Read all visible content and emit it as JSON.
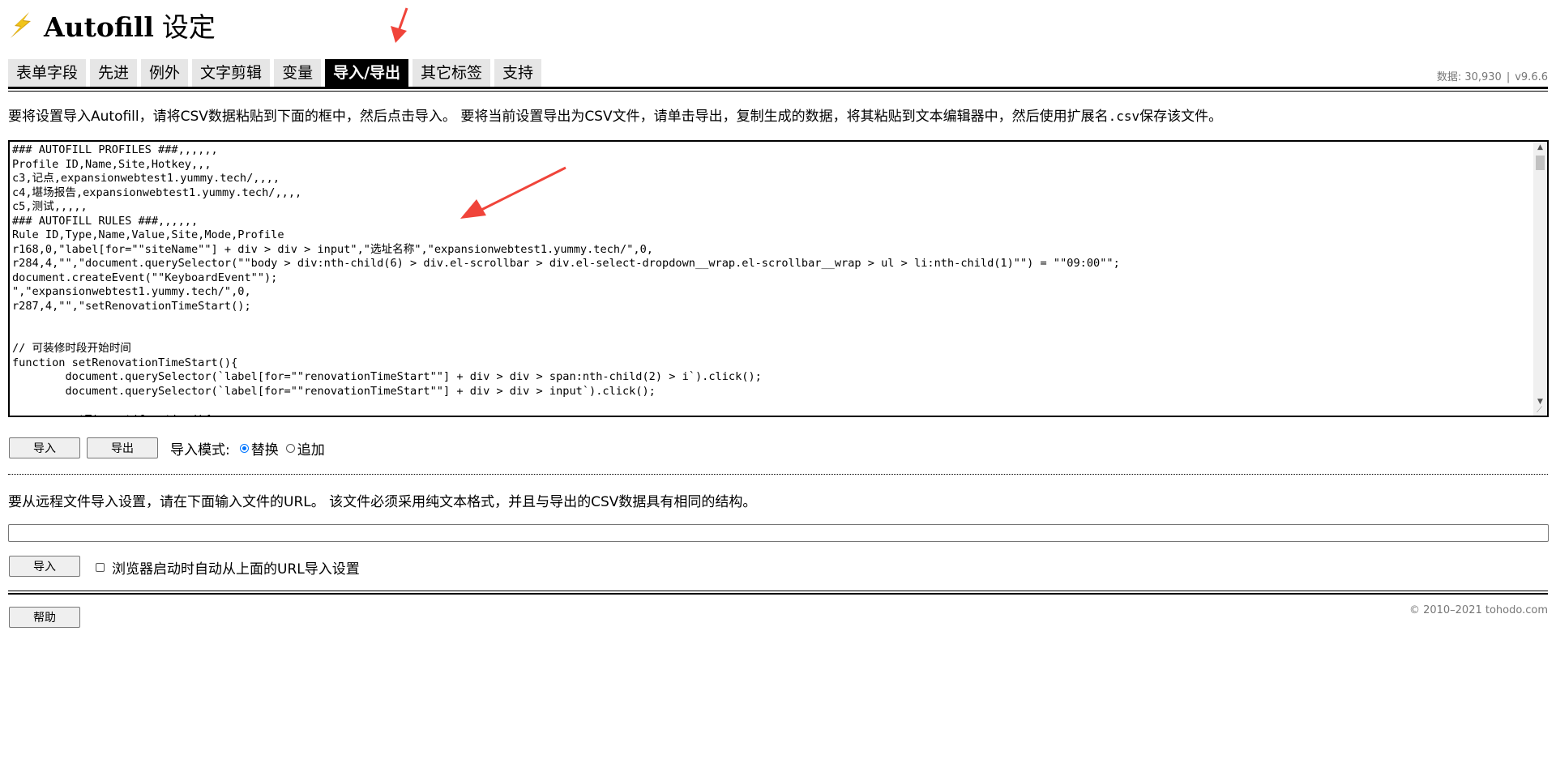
{
  "header": {
    "title": "Autofill",
    "title_suffix": "设定"
  },
  "tabs": [
    {
      "label": "表单字段",
      "active": false
    },
    {
      "label": "先进",
      "active": false
    },
    {
      "label": "例外",
      "active": false
    },
    {
      "label": "文字剪辑",
      "active": false
    },
    {
      "label": "变量",
      "active": false
    },
    {
      "label": "导入/导出",
      "active": true
    },
    {
      "label": "其它标签",
      "active": false
    },
    {
      "label": "支持",
      "active": false
    }
  ],
  "status": {
    "data_count": "数据: 30,930",
    "separator": "|",
    "version": "v9.6.6"
  },
  "intro": {
    "text_before": "要将设置导入Autofill，请将CSV数据粘贴到下面的框中，然后点击导入。 要将当前设置导出为CSV文件，请单击导出，复制生成的数据，将其粘贴到文本编辑器中，然后使用扩展名",
    "extension": ".csv",
    "text_after": "保存该文件。"
  },
  "csv_lines": [
    "### AUTOFILL PROFILES ###,,,,,,",
    "Profile ID,Name,Site,Hotkey,,,",
    "c3,记点,expansionwebtest1.yummy.tech/,,,,",
    "c4,堪场报告,expansionwebtest1.yummy.tech/,,,,",
    "c5,测试,,,,,",
    "### AUTOFILL RULES ###,,,,,,",
    "Rule ID,Type,Name,Value,Site,Mode,Profile",
    "r168,0,\"label[for=\"\"siteName\"\"] + div > div > input\",\"选址名称\",\"expansionwebtest1.yummy.tech/\",0,",
    "r284,4,\"\",\"document.querySelector(\"\"body > div:nth-child(6) > div.el-scrollbar > div.el-select-dropdown__wrap.el-scrollbar__wrap > ul > li:nth-child(1)\"\") = \"\"09:00\"\";",
    "document.createEvent(\"\"KeyboardEvent\"\");",
    "\",\"expansionwebtest1.yummy.tech/\",0,",
    "r287,4,\"\",\"setRenovationTimeStart();",
    "",
    "",
    "// 可装修时段开始时间",
    "function setRenovationTimeStart(){",
    "        document.querySelector(`label[for=\"\"renovationTimeStart\"\"] + div > div > span:nth-child(2) > i`).click();",
    "        document.querySelector(`label[for=\"\"renovationTimeStart\"\"] + div > div > input`).click();",
    "",
    "        setTimeout(function(){"
  ],
  "actions": {
    "import_label": "导入",
    "export_label": "导出",
    "mode_label": "导入模式:",
    "mode_options": [
      {
        "label": "替换",
        "checked": true
      },
      {
        "label": "追加",
        "checked": false
      }
    ]
  },
  "remote": {
    "text": "要从远程文件导入设置，请在下面输入文件的URL。 该文件必须采用纯文本格式，并且与导出的CSV数据具有相同的结构。",
    "url_value": "",
    "import_label": "导入",
    "auto_import_label": "浏览器启动时自动从上面的URL导入设置",
    "auto_import_checked": false
  },
  "footer": {
    "help_label": "帮助",
    "copyright": "© 2010–2021 tohodo.com"
  },
  "colors": {
    "accent": "#0075ff",
    "annotation_arrow": "#f0443a",
    "tab_bg": "#e6e6e6",
    "tab_active_bg": "#000000"
  }
}
